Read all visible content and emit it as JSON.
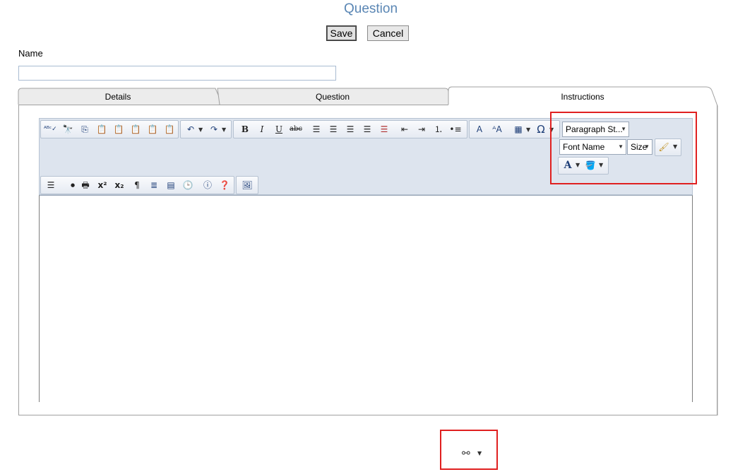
{
  "page": {
    "title": "Question"
  },
  "actions": {
    "save_label": "Save",
    "cancel_label": "Cancel"
  },
  "form": {
    "name_label": "Name",
    "name_value": ""
  },
  "tabs": [
    {
      "label": "Details"
    },
    {
      "label": "Question"
    },
    {
      "label": "Instructions",
      "selected": true
    }
  ],
  "editor": {
    "paragraph_style": "Paragraph St...",
    "font_name": "Font Name",
    "font_size": "Size",
    "content": ""
  },
  "icons": {
    "spellcheck": "spellcheck-icon",
    "find": "find-replace-icon",
    "bold_glyph": "B",
    "italic_glyph": "I",
    "underline_glyph": "U",
    "strike_glyph": "abc",
    "font_color_glyph": "A",
    "special_char_glyph": "Ω"
  },
  "colors": {
    "title": "#5a86b4",
    "highlight": "#e02020",
    "toolbar_bg": "#dde4ee"
  }
}
